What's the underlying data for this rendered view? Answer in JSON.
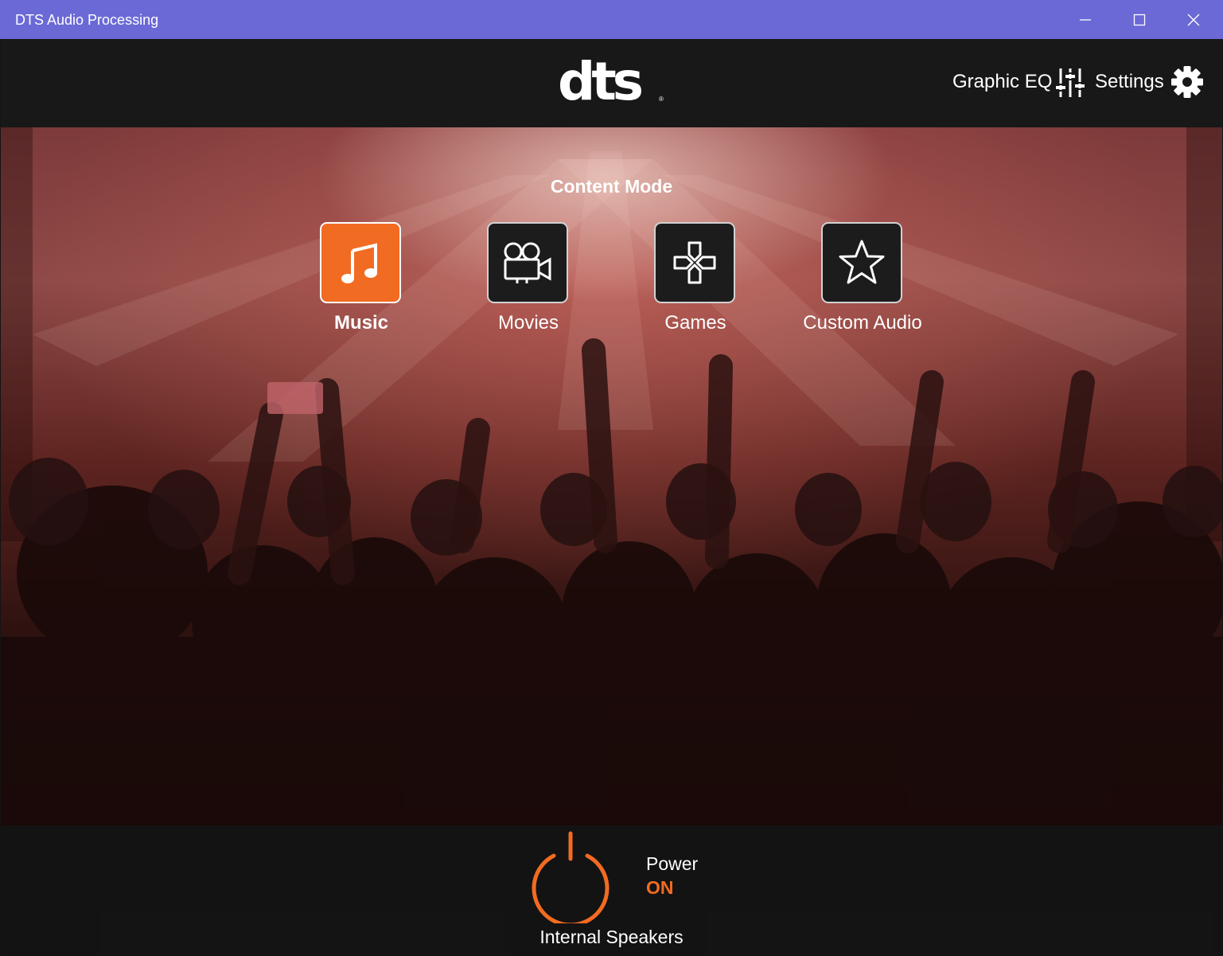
{
  "window": {
    "title": "DTS Audio Processing",
    "minimize_icon": "minimize-icon",
    "maximize_icon": "maximize-icon",
    "close_icon": "close-icon",
    "titlebar_color": "#6b69d6"
  },
  "header": {
    "logo_text": "dts",
    "logo_mark": "®",
    "graphic_eq_label": "Graphic EQ",
    "graphic_eq_icon": "sliders-icon",
    "settings_label": "Settings",
    "settings_icon": "gear-icon"
  },
  "content_mode": {
    "title": "Content Mode",
    "selected": "Music",
    "modes": [
      {
        "label": "Music",
        "icon": "music-note-icon",
        "selected": true
      },
      {
        "label": "Movies",
        "icon": "movie-camera-icon",
        "selected": false
      },
      {
        "label": "Games",
        "icon": "gamepad-icon",
        "selected": false
      },
      {
        "label": "Custom Audio",
        "icon": "star-icon",
        "selected": false
      }
    ]
  },
  "footer": {
    "power_icon": "power-icon",
    "power_label": "Power",
    "power_state": "ON",
    "device_label": "Internal Speakers"
  },
  "colors": {
    "accent": "#f26b22",
    "background": "#181818"
  }
}
